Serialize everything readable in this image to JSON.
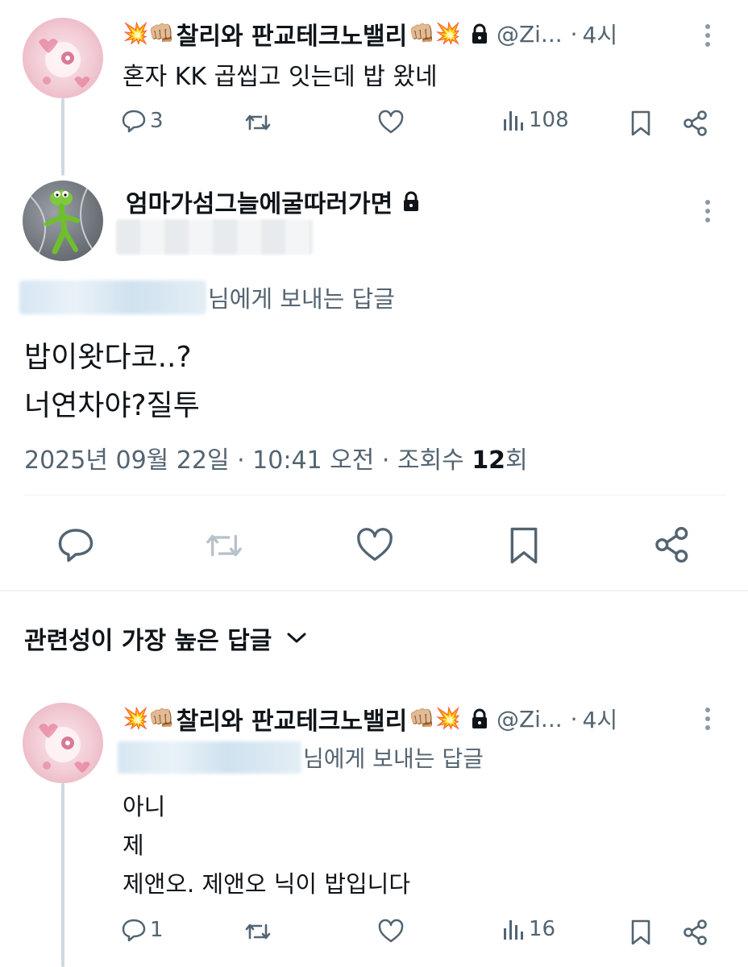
{
  "tweet1": {
    "display_name": "찰리와 판교테크노밸리",
    "emoji_left": "💥👊🏼",
    "emoji_right": "👊🏼💥",
    "handle": "@Zi...",
    "separator": "·",
    "time": "4시",
    "text": "혼자 KK 곱씹고 잇는데 밥 왔네",
    "replies": "3",
    "views": "108"
  },
  "main": {
    "display_name": "엄마가섬그늘에굴따러가면",
    "replying_suffix": "님에게 보내는 답글",
    "text_line1": "밥이왓다코..?",
    "text_line2": "너연차야?질투",
    "timestamp": "2025년 09월 22일 · 10:41 오전 · 조회수 ",
    "views_count": "12",
    "views_suffix": "회"
  },
  "section": {
    "title": "관련성이 가장 높은 답글"
  },
  "tweet2": {
    "display_name": "찰리와 판교테크노밸리",
    "emoji_left": "💥👊🏼",
    "emoji_right": "👊🏼💥",
    "handle": "@Zi...",
    "separator": "·",
    "time": "4시",
    "replying_suffix": "님에게 보내는 답글",
    "line1": "아니",
    "line2": "제",
    "line3": "제앤오. 제앤오 닉이 밥입니다",
    "replies": "1",
    "views": "16"
  },
  "colors": {
    "text": "#0f1419",
    "muted": "#536471",
    "divider": "#eff3f4",
    "thread_line": "#cfd9de"
  }
}
